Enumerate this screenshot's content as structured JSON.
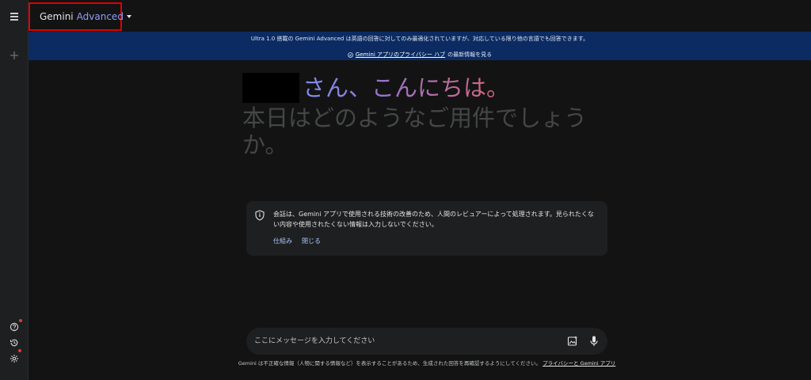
{
  "header": {
    "model_name": "Gemini",
    "model_tier": "Advanced"
  },
  "banner": {
    "line1": "Ultra 1.0 搭載の Gemini Advanced は英語の回答に対してのみ最適化されていますが、対応している限り他の言語でも回答できます。",
    "link": "Gemini アプリのプライバシー ハブ",
    "link_suffix": "の最新情報を見る"
  },
  "greeting": {
    "hello": "さん、こんにちは。",
    "subtitle": "本日はどのようなご用件でしょうか。"
  },
  "notice": {
    "text": "会話は、Gemini アプリで使用される技術の改善のため、人間のレビュアーによって処理されます。見られたくない内容や使用されたくない情報は入力しないでください。",
    "link_how": "仕組み",
    "link_close": "閉じる"
  },
  "input": {
    "placeholder": "ここにメッセージを入力してください"
  },
  "footer": {
    "text": "Gemini は不正確な情報（人物に関する情報など）を表示することがあるため、生成された回答を再確認するようにしてください。",
    "link": "プライバシーと Gemini アプリ"
  },
  "colors": {
    "background": "#131314",
    "banner": "#0b2b62",
    "accent_link": "#a8c7fa",
    "highlight_border": "#e00000"
  },
  "icons": [
    "menu-icon",
    "add-icon",
    "help-icon",
    "history-icon",
    "settings-icon",
    "shield-icon",
    "image-icon",
    "mic-icon",
    "check-circle-icon"
  ]
}
